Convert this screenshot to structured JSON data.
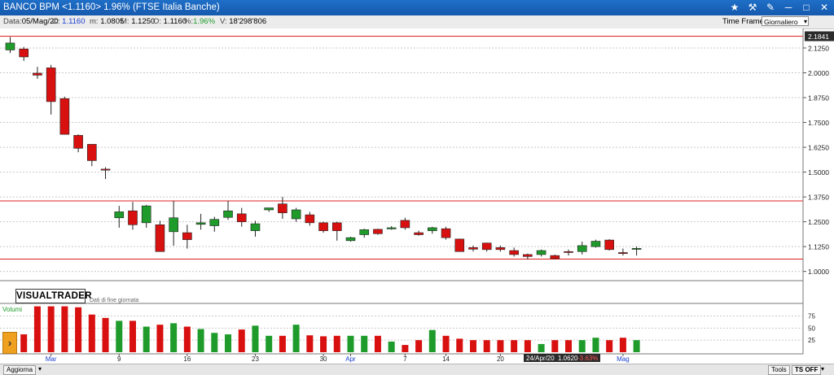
{
  "window": {
    "title": "BANCO BPM <1.1160> 1.96% (FTSE Italia Banche)",
    "icons": [
      "star-icon",
      "hammer-icon",
      "wrench-icon",
      "minimize-icon",
      "maximize-icon",
      "close-icon"
    ]
  },
  "info": {
    "date_label": "Data:",
    "date": "05/Mag/20",
    "close_label": "C:",
    "close": "1.1160",
    "min_label": "m:",
    "min": "1.0805",
    "max_label": "M:",
    "max": "1.1250",
    "open_label": "O:",
    "open": "1.1160",
    "pct_label": "%:",
    "pct": "1.96%",
    "vol_label": "V:",
    "vol": "18'298'806",
    "timeframe_label": "Time Frame",
    "timeframe_value": "Giornaliero"
  },
  "logo": {
    "name": "VISUALTRADER",
    "sub": "Dati di fine giornata"
  },
  "bottom": {
    "refresh": "Aggiorna",
    "tools": "Tools",
    "ts": "TS OFF"
  },
  "colors": {
    "up": "#1e9b2a",
    "down": "#d81010",
    "hline": "#e02020",
    "title": "#1a62b8"
  },
  "chart_data": {
    "type": "candlestick",
    "price_axis": {
      "ticks": [
        "2.1250",
        "2.0000",
        "1.8750",
        "1.7500",
        "1.6250",
        "1.5000",
        "1.3750",
        "1.2500",
        "1.1250",
        "1.0000"
      ],
      "ylim": [
        0.97,
        2.215
      ]
    },
    "price_tag": "2.1841",
    "hlines": [
      2.1841,
      1.355,
      1.062
    ],
    "candles": [
      {
        "o": 2.115,
        "h": 2.18,
        "l": 2.1,
        "c": 2.15
      },
      {
        "o": 2.12,
        "h": 2.13,
        "l": 2.06,
        "c": 2.08
      },
      {
        "o": 1.998,
        "h": 2.03,
        "l": 1.97,
        "c": 1.988
      },
      {
        "o": 2.025,
        "h": 2.04,
        "l": 1.79,
        "c": 1.855
      },
      {
        "o": 1.87,
        "h": 1.88,
        "l": 1.69,
        "c": 1.69
      },
      {
        "o": 1.685,
        "h": 1.69,
        "l": 1.6,
        "c": 1.62
      },
      {
        "o": 1.64,
        "h": 1.64,
        "l": 1.53,
        "c": 1.558
      },
      {
        "o": 1.515,
        "h": 1.525,
        "l": 1.465,
        "c": 1.51
      },
      {
        "o": 1.27,
        "h": 1.33,
        "l": 1.22,
        "c": 1.3
      },
      {
        "o": 1.305,
        "h": 1.35,
        "l": 1.21,
        "c": 1.235
      },
      {
        "o": 1.245,
        "h": 1.335,
        "l": 1.22,
        "c": 1.33
      },
      {
        "o": 1.235,
        "h": 1.255,
        "l": 1.1,
        "c": 1.1
      },
      {
        "o": 1.2,
        "h": 1.355,
        "l": 1.13,
        "c": 1.27
      },
      {
        "o": 1.195,
        "h": 1.235,
        "l": 1.115,
        "c": 1.16
      },
      {
        "o": 1.237,
        "h": 1.29,
        "l": 1.21,
        "c": 1.245
      },
      {
        "o": 1.23,
        "h": 1.275,
        "l": 1.2,
        "c": 1.262
      },
      {
        "o": 1.272,
        "h": 1.355,
        "l": 1.26,
        "c": 1.305
      },
      {
        "o": 1.29,
        "h": 1.32,
        "l": 1.225,
        "c": 1.25
      },
      {
        "o": 1.205,
        "h": 1.255,
        "l": 1.175,
        "c": 1.24
      },
      {
        "o": 1.31,
        "h": 1.32,
        "l": 1.3,
        "c": 1.32
      },
      {
        "o": 1.34,
        "h": 1.375,
        "l": 1.265,
        "c": 1.295
      },
      {
        "o": 1.265,
        "h": 1.32,
        "l": 1.25,
        "c": 1.31
      },
      {
        "o": 1.285,
        "h": 1.3,
        "l": 1.23,
        "c": 1.245
      },
      {
        "o": 1.245,
        "h": 1.25,
        "l": 1.195,
        "c": 1.205
      },
      {
        "o": 1.245,
        "h": 1.25,
        "l": 1.155,
        "c": 1.205
      },
      {
        "o": 1.155,
        "h": 1.175,
        "l": 1.15,
        "c": 1.17
      },
      {
        "o": 1.185,
        "h": 1.215,
        "l": 1.17,
        "c": 1.21
      },
      {
        "o": 1.212,
        "h": 1.215,
        "l": 1.185,
        "c": 1.19
      },
      {
        "o": 1.214,
        "h": 1.228,
        "l": 1.21,
        "c": 1.22
      },
      {
        "o": 1.257,
        "h": 1.27,
        "l": 1.21,
        "c": 1.22
      },
      {
        "o": 1.195,
        "h": 1.205,
        "l": 1.18,
        "c": 1.185
      },
      {
        "o": 1.205,
        "h": 1.225,
        "l": 1.19,
        "c": 1.22
      },
      {
        "o": 1.215,
        "h": 1.225,
        "l": 1.16,
        "c": 1.17
      },
      {
        "o": 1.163,
        "h": 1.165,
        "l": 1.1,
        "c": 1.1
      },
      {
        "o": 1.12,
        "h": 1.13,
        "l": 1.1,
        "c": 1.112
      },
      {
        "o": 1.143,
        "h": 1.145,
        "l": 1.1,
        "c": 1.11
      },
      {
        "o": 1.12,
        "h": 1.13,
        "l": 1.1,
        "c": 1.11
      },
      {
        "o": 1.105,
        "h": 1.12,
        "l": 1.075,
        "c": 1.085
      },
      {
        "o": 1.085,
        "h": 1.09,
        "l": 1.06,
        "c": 1.075
      },
      {
        "o": 1.085,
        "h": 1.11,
        "l": 1.075,
        "c": 1.105
      },
      {
        "o": 1.08,
        "h": 1.085,
        "l": 1.062,
        "c": 1.065
      },
      {
        "o": 1.1,
        "h": 1.11,
        "l": 1.08,
        "c": 1.098
      },
      {
        "o": 1.1,
        "h": 1.15,
        "l": 1.085,
        "c": 1.13
      },
      {
        "o": 1.125,
        "h": 1.16,
        "l": 1.12,
        "c": 1.152
      },
      {
        "o": 1.158,
        "h": 1.162,
        "l": 1.105,
        "c": 1.11
      },
      {
        "o": 1.095,
        "h": 1.115,
        "l": 1.08,
        "c": 1.09
      },
      {
        "o": 1.114,
        "h": 1.125,
        "l": 1.08,
        "c": 1.116
      }
    ],
    "volume": {
      "label": "Volumi",
      "ticks": [
        "75",
        "50",
        "25"
      ],
      "ylim": [
        0,
        96
      ],
      "values": [
        33,
        37,
        95,
        95,
        95,
        93,
        78,
        71,
        65,
        65,
        53,
        57,
        60,
        53,
        48,
        40,
        37,
        47,
        55,
        34,
        34,
        57,
        35,
        33,
        34,
        34,
        34,
        34,
        22,
        15,
        25,
        46,
        34,
        28,
        25,
        25,
        25,
        25,
        25,
        17,
        25,
        25,
        25,
        30,
        25,
        30,
        25
      ]
    },
    "x_labels": [
      {
        "i": 3,
        "text": "Mar",
        "style": "month"
      },
      {
        "i": 8,
        "text": "9",
        "style": "day"
      },
      {
        "i": 13,
        "text": "16",
        "style": "day"
      },
      {
        "i": 18,
        "text": "23",
        "style": "day"
      },
      {
        "i": 23,
        "text": "30",
        "style": "day"
      },
      {
        "i": 25,
        "text": "Apr",
        "style": "month"
      },
      {
        "i": 29,
        "text": "7",
        "style": "day"
      },
      {
        "i": 32,
        "text": "14",
        "style": "day"
      },
      {
        "i": 36,
        "text": "20",
        "style": "day"
      },
      {
        "i": 45,
        "text": "Mag",
        "style": "month"
      }
    ],
    "hover": {
      "date": "24/Apr/20",
      "price": "1.0620",
      "pct": "-3.63%"
    }
  }
}
